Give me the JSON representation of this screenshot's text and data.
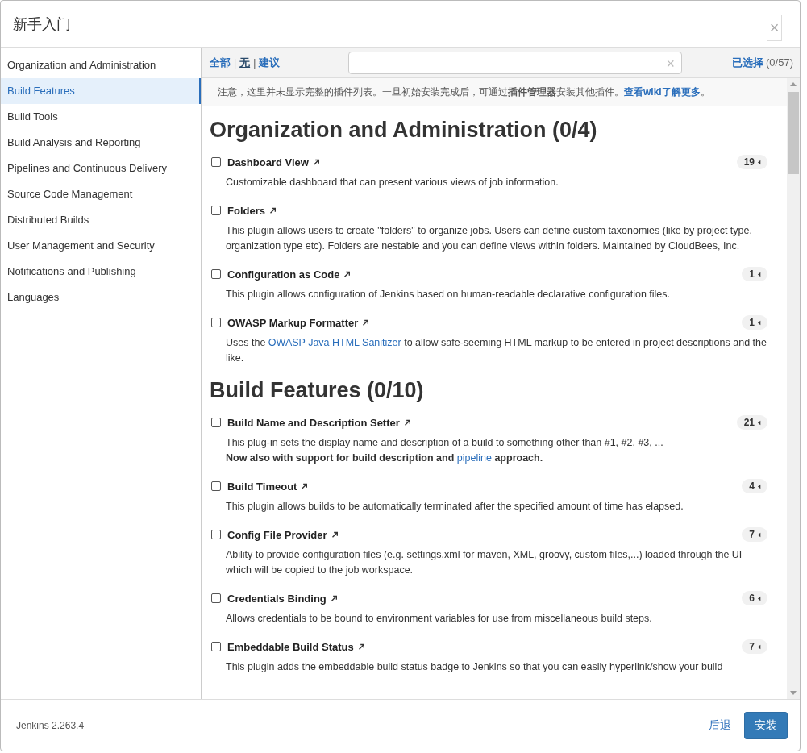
{
  "dialog": {
    "title": "新手入门",
    "close": "×"
  },
  "sidebar": {
    "items": [
      {
        "label": "Organization and Administration",
        "selected": false
      },
      {
        "label": "Build Features",
        "selected": true
      },
      {
        "label": "Build Tools",
        "selected": false
      },
      {
        "label": "Build Analysis and Reporting",
        "selected": false
      },
      {
        "label": "Pipelines and Continuous Delivery",
        "selected": false
      },
      {
        "label": "Source Code Management",
        "selected": false
      },
      {
        "label": "Distributed Builds",
        "selected": false
      },
      {
        "label": "User Management and Security",
        "selected": false
      },
      {
        "label": "Notifications and Publishing",
        "selected": false
      },
      {
        "label": "Languages",
        "selected": false
      }
    ]
  },
  "toolbar": {
    "filters": [
      {
        "label": "全部",
        "selected": false
      },
      {
        "label": "无",
        "selected": true
      },
      {
        "label": "建议",
        "selected": false
      }
    ],
    "separator": "|",
    "clear": "×",
    "selected_label": "已选择",
    "selected_count": "(0/57)"
  },
  "notice": [
    {
      "text": "注意，这里并未显示完整的插件列表。一旦初始安装完成后，可通过**插件管理器**安装其他插件。",
      "kind": "text"
    },
    {
      "text": "查看wiki了解更多",
      "kind": "link"
    },
    {
      "text": "。",
      "kind": "text"
    }
  ],
  "sections": [
    {
      "title": "Organization and Administration (0/4)",
      "plugins": [
        {
          "name": "Dashboard View",
          "checked": false,
          "count": "19",
          "description": [
            [
              {
                "text": "Customizable dashboard that can present various views of job information.",
                "kind": "text"
              }
            ]
          ]
        },
        {
          "name": "Folders",
          "checked": false,
          "description": [
            [
              {
                "text": "This plugin allows users to create \"folders\" to organize jobs. Users can define custom taxonomies (like by project type, organization type etc). Folders are nestable and you can define views within folders. Maintained by CloudBees, Inc.",
                "kind": "text"
              }
            ]
          ]
        },
        {
          "name": "Configuration as Code",
          "checked": false,
          "count": "1",
          "description": [
            [
              {
                "text": "This plugin allows configuration of Jenkins based on human-readable declarative configuration files.",
                "kind": "text"
              }
            ]
          ]
        },
        {
          "name": "OWASP Markup Formatter",
          "checked": false,
          "count": "1",
          "description": [
            [
              {
                "text": "Uses the",
                "kind": "text"
              },
              {
                "text": "OWASP Java HTML Sanitizer",
                "kind": "link"
              },
              {
                "text": "to allow safe-seeming HTML markup to be entered in project descriptions and the like.",
                "kind": "text"
              }
            ]
          ]
        }
      ]
    },
    {
      "title": "Build Features (0/10)",
      "plugins": [
        {
          "name": "Build Name and Description Setter",
          "checked": false,
          "count": "21",
          "description": [
            [
              {
                "text": "This plug-in sets the display name and description of a build to something other than #1, #2, #3, ...",
                "kind": "text"
              }
            ],
            [
              {
                "text": "**Now also with support for build description and**",
                "kind": "text"
              },
              {
                "text": "pipeline",
                "kind": "link"
              },
              {
                "text": "**approach.**",
                "kind": "text"
              }
            ]
          ]
        },
        {
          "name": "Build Timeout",
          "checked": false,
          "count": "4",
          "description": [
            [
              {
                "text": "This plugin allows builds to be automatically terminated after the specified amount of time has elapsed.",
                "kind": "text"
              }
            ]
          ]
        },
        {
          "name": "Config File Provider",
          "checked": false,
          "count": "7",
          "description": [
            [
              {
                "text": "Ability to provide configuration files (e.g. settings.xml for maven, XML, groovy, custom files,...) loaded through the UI which will be copied to the job workspace.",
                "kind": "text"
              }
            ]
          ]
        },
        {
          "name": "Credentials Binding",
          "checked": false,
          "count": "6",
          "description": [
            [
              {
                "text": "Allows credentials to be bound to environment variables for use from miscellaneous build steps.",
                "kind": "text"
              }
            ]
          ]
        },
        {
          "name": "Embeddable Build Status",
          "checked": false,
          "count": "7",
          "description": [
            [
              {
                "text": "This plugin adds the embeddable build status badge to Jenkins so that you can easily hyperlink/show your build",
                "kind": "text"
              }
            ]
          ]
        }
      ]
    }
  ],
  "footer": {
    "version": "Jenkins 2.263.4",
    "back": "后退",
    "install": "安装"
  }
}
